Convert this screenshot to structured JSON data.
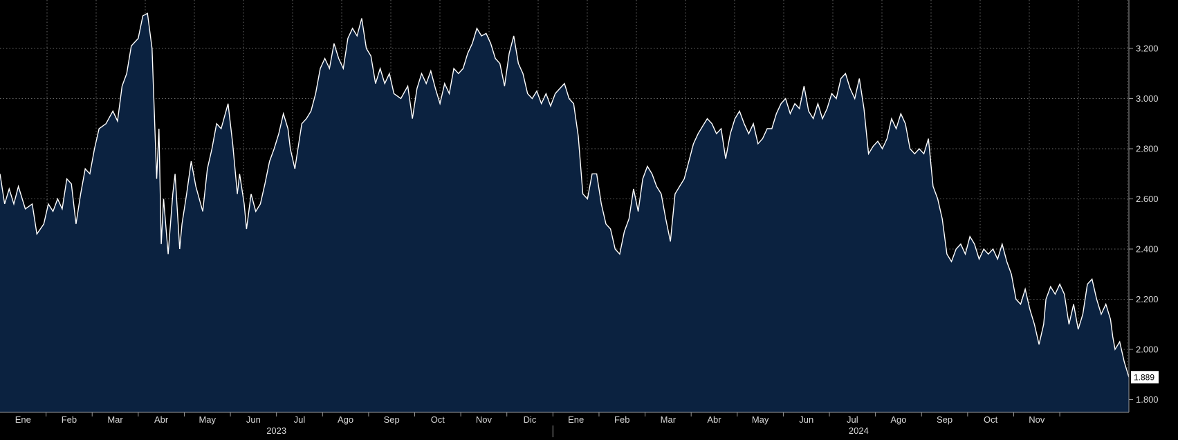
{
  "chart_data": {
    "type": "area",
    "title": "",
    "xlabel": "",
    "ylabel": "",
    "x_ticks": [
      "Ene",
      "Feb",
      "Mar",
      "Abr",
      "May",
      "Jun",
      "Jul",
      "Ago",
      "Sep",
      "Oct",
      "Nov",
      "Dic",
      "Ene",
      "Feb",
      "Mar",
      "Abr",
      "May",
      "Jun",
      "Jul",
      "Ago",
      "Sep",
      "Oct",
      "Nov"
    ],
    "years": [
      "2023",
      "2024"
    ],
    "y_ticks": [
      "1.800",
      "2.000",
      "2.200",
      "2.400",
      "2.600",
      "2.800",
      "3.000",
      "3.200"
    ],
    "ylim": [
      1.75,
      3.4
    ],
    "xlim": [
      0,
      23.5
    ],
    "grid": true,
    "last_value_label": "1.889",
    "colors": {
      "background": "#000000",
      "fill": "#0b2240",
      "line": "#ffffff",
      "grid": "#6b6b6b"
    },
    "series": [
      {
        "values": [
          [
            0.0,
            2.7
          ],
          [
            0.1,
            2.58
          ],
          [
            0.2,
            2.64
          ],
          [
            0.3,
            2.58
          ],
          [
            0.4,
            2.65
          ],
          [
            0.55,
            2.56
          ],
          [
            0.7,
            2.58
          ],
          [
            0.8,
            2.46
          ],
          [
            0.95,
            2.5
          ],
          [
            1.05,
            2.58
          ],
          [
            1.15,
            2.55
          ],
          [
            1.25,
            2.6
          ],
          [
            1.35,
            2.56
          ],
          [
            1.45,
            2.68
          ],
          [
            1.55,
            2.66
          ],
          [
            1.65,
            2.5
          ],
          [
            1.75,
            2.62
          ],
          [
            1.85,
            2.72
          ],
          [
            1.95,
            2.7
          ],
          [
            2.05,
            2.8
          ],
          [
            2.15,
            2.88
          ],
          [
            2.3,
            2.9
          ],
          [
            2.45,
            2.95
          ],
          [
            2.55,
            2.91
          ],
          [
            2.65,
            3.05
          ],
          [
            2.75,
            3.1
          ],
          [
            2.85,
            3.21
          ],
          [
            3.0,
            3.24
          ],
          [
            3.1,
            3.33
          ],
          [
            3.2,
            3.34
          ],
          [
            3.3,
            3.2
          ],
          [
            3.4,
            2.68
          ],
          [
            3.45,
            2.88
          ],
          [
            3.5,
            2.42
          ],
          [
            3.55,
            2.6
          ],
          [
            3.65,
            2.38
          ],
          [
            3.75,
            2.62
          ],
          [
            3.8,
            2.7
          ],
          [
            3.9,
            2.4
          ],
          [
            3.95,
            2.5
          ],
          [
            4.05,
            2.62
          ],
          [
            4.15,
            2.75
          ],
          [
            4.25,
            2.65
          ],
          [
            4.4,
            2.55
          ],
          [
            4.5,
            2.72
          ],
          [
            4.6,
            2.8
          ],
          [
            4.7,
            2.9
          ],
          [
            4.8,
            2.88
          ],
          [
            4.95,
            2.98
          ],
          [
            5.05,
            2.82
          ],
          [
            5.15,
            2.62
          ],
          [
            5.2,
            2.7
          ],
          [
            5.3,
            2.58
          ],
          [
            5.35,
            2.48
          ],
          [
            5.45,
            2.62
          ],
          [
            5.55,
            2.55
          ],
          [
            5.65,
            2.58
          ],
          [
            5.75,
            2.66
          ],
          [
            5.85,
            2.75
          ],
          [
            5.95,
            2.8
          ],
          [
            6.05,
            2.86
          ],
          [
            6.15,
            2.94
          ],
          [
            6.25,
            2.88
          ],
          [
            6.3,
            2.8
          ],
          [
            6.4,
            2.72
          ],
          [
            6.45,
            2.78
          ],
          [
            6.55,
            2.9
          ],
          [
            6.65,
            2.92
          ],
          [
            6.75,
            2.95
          ],
          [
            6.85,
            3.02
          ],
          [
            6.95,
            3.12
          ],
          [
            7.05,
            3.16
          ],
          [
            7.15,
            3.12
          ],
          [
            7.25,
            3.22
          ],
          [
            7.35,
            3.16
          ],
          [
            7.45,
            3.12
          ],
          [
            7.55,
            3.24
          ],
          [
            7.65,
            3.28
          ],
          [
            7.75,
            3.25
          ],
          [
            7.85,
            3.32
          ],
          [
            7.95,
            3.2
          ],
          [
            8.05,
            3.17
          ],
          [
            8.15,
            3.06
          ],
          [
            8.25,
            3.12
          ],
          [
            8.35,
            3.06
          ],
          [
            8.45,
            3.1
          ],
          [
            8.55,
            3.02
          ],
          [
            8.7,
            3.0
          ],
          [
            8.85,
            3.05
          ],
          [
            8.95,
            2.92
          ],
          [
            9.05,
            3.04
          ],
          [
            9.15,
            3.1
          ],
          [
            9.25,
            3.06
          ],
          [
            9.35,
            3.11
          ],
          [
            9.45,
            3.04
          ],
          [
            9.55,
            2.98
          ],
          [
            9.65,
            3.06
          ],
          [
            9.75,
            3.02
          ],
          [
            9.85,
            3.12
          ],
          [
            9.95,
            3.1
          ],
          [
            10.05,
            3.12
          ],
          [
            10.15,
            3.18
          ],
          [
            10.25,
            3.22
          ],
          [
            10.35,
            3.28
          ],
          [
            10.45,
            3.25
          ],
          [
            10.55,
            3.26
          ],
          [
            10.65,
            3.22
          ],
          [
            10.75,
            3.16
          ],
          [
            10.85,
            3.14
          ],
          [
            10.95,
            3.05
          ],
          [
            11.05,
            3.18
          ],
          [
            11.15,
            3.25
          ],
          [
            11.25,
            3.14
          ],
          [
            11.35,
            3.1
          ],
          [
            11.45,
            3.02
          ],
          [
            11.55,
            3.0
          ],
          [
            11.65,
            3.03
          ],
          [
            11.75,
            2.98
          ],
          [
            11.85,
            3.02
          ],
          [
            11.95,
            2.97
          ],
          [
            12.05,
            3.02
          ],
          [
            12.15,
            3.04
          ],
          [
            12.25,
            3.06
          ],
          [
            12.35,
            3.0
          ],
          [
            12.45,
            2.98
          ],
          [
            12.55,
            2.85
          ],
          [
            12.65,
            2.62
          ],
          [
            12.75,
            2.6
          ],
          [
            12.85,
            2.7
          ],
          [
            12.95,
            2.7
          ],
          [
            13.05,
            2.58
          ],
          [
            13.15,
            2.5
          ],
          [
            13.25,
            2.48
          ],
          [
            13.35,
            2.4
          ],
          [
            13.45,
            2.38
          ],
          [
            13.55,
            2.47
          ],
          [
            13.65,
            2.52
          ],
          [
            13.75,
            2.64
          ],
          [
            13.85,
            2.55
          ],
          [
            13.95,
            2.68
          ],
          [
            14.05,
            2.73
          ],
          [
            14.15,
            2.7
          ],
          [
            14.25,
            2.65
          ],
          [
            14.35,
            2.62
          ],
          [
            14.45,
            2.52
          ],
          [
            14.55,
            2.43
          ],
          [
            14.65,
            2.62
          ],
          [
            14.75,
            2.65
          ],
          [
            14.85,
            2.68
          ],
          [
            14.95,
            2.75
          ],
          [
            15.05,
            2.82
          ],
          [
            15.15,
            2.86
          ],
          [
            15.25,
            2.89
          ],
          [
            15.35,
            2.92
          ],
          [
            15.45,
            2.9
          ],
          [
            15.55,
            2.86
          ],
          [
            15.65,
            2.88
          ],
          [
            15.75,
            2.76
          ],
          [
            15.85,
            2.86
          ],
          [
            15.95,
            2.92
          ],
          [
            16.05,
            2.95
          ],
          [
            16.15,
            2.9
          ],
          [
            16.25,
            2.86
          ],
          [
            16.35,
            2.9
          ],
          [
            16.45,
            2.82
          ],
          [
            16.55,
            2.84
          ],
          [
            16.65,
            2.88
          ],
          [
            16.75,
            2.88
          ],
          [
            16.85,
            2.94
          ],
          [
            16.95,
            2.98
          ],
          [
            17.05,
            3.0
          ],
          [
            17.15,
            2.94
          ],
          [
            17.25,
            2.98
          ],
          [
            17.35,
            2.96
          ],
          [
            17.45,
            3.05
          ],
          [
            17.55,
            2.95
          ],
          [
            17.65,
            2.92
          ],
          [
            17.75,
            2.98
          ],
          [
            17.85,
            2.92
          ],
          [
            17.95,
            2.96
          ],
          [
            18.05,
            3.02
          ],
          [
            18.15,
            3.0
          ],
          [
            18.25,
            3.08
          ],
          [
            18.35,
            3.1
          ],
          [
            18.45,
            3.04
          ],
          [
            18.55,
            3.0
          ],
          [
            18.65,
            3.08
          ],
          [
            18.75,
            2.96
          ],
          [
            18.85,
            2.78
          ],
          [
            18.95,
            2.81
          ],
          [
            19.05,
            2.83
          ],
          [
            19.15,
            2.8
          ],
          [
            19.25,
            2.84
          ],
          [
            19.35,
            2.92
          ],
          [
            19.45,
            2.88
          ],
          [
            19.55,
            2.94
          ],
          [
            19.65,
            2.9
          ],
          [
            19.75,
            2.8
          ],
          [
            19.85,
            2.78
          ],
          [
            19.95,
            2.8
          ],
          [
            20.05,
            2.78
          ],
          [
            20.15,
            2.84
          ],
          [
            20.25,
            2.65
          ],
          [
            20.35,
            2.6
          ],
          [
            20.45,
            2.52
          ],
          [
            20.55,
            2.38
          ],
          [
            20.65,
            2.35
          ],
          [
            20.75,
            2.4
          ],
          [
            20.85,
            2.42
          ],
          [
            20.95,
            2.38
          ],
          [
            21.05,
            2.45
          ],
          [
            21.15,
            2.42
          ],
          [
            21.25,
            2.36
          ],
          [
            21.35,
            2.4
          ],
          [
            21.45,
            2.38
          ],
          [
            21.55,
            2.4
          ],
          [
            21.65,
            2.36
          ],
          [
            21.75,
            2.42
          ],
          [
            21.85,
            2.35
          ],
          [
            21.95,
            2.3
          ],
          [
            22.05,
            2.2
          ],
          [
            22.15,
            2.18
          ],
          [
            22.25,
            2.24
          ],
          [
            22.35,
            2.16
          ],
          [
            22.45,
            2.1
          ],
          [
            22.55,
            2.02
          ],
          [
            22.65,
            2.1
          ],
          [
            22.7,
            2.2
          ],
          [
            22.8,
            2.25
          ],
          [
            22.9,
            2.22
          ],
          [
            23.0,
            2.26
          ],
          [
            23.1,
            2.22
          ],
          [
            23.2,
            2.1
          ],
          [
            23.3,
            2.18
          ],
          [
            23.4,
            2.08
          ],
          [
            23.5,
            2.14
          ],
          [
            23.55,
            2.2
          ],
          [
            23.6,
            2.26
          ],
          [
            23.7,
            2.28
          ],
          [
            23.8,
            2.2
          ],
          [
            23.9,
            2.14
          ],
          [
            24.0,
            2.18
          ],
          [
            24.1,
            2.12
          ],
          [
            24.15,
            2.05
          ],
          [
            24.2,
            2.0
          ],
          [
            24.3,
            2.03
          ],
          [
            24.4,
            1.95
          ],
          [
            24.5,
            1.889
          ]
        ]
      }
    ]
  }
}
